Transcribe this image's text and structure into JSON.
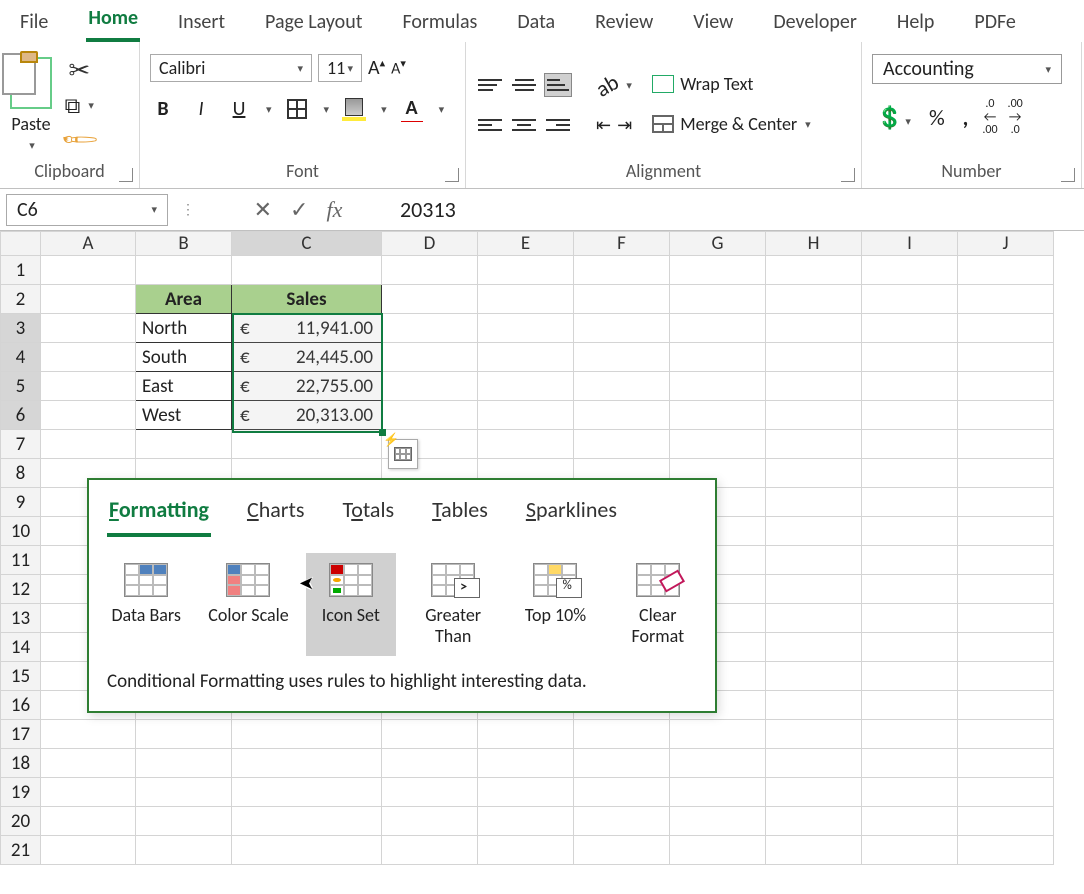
{
  "tabs": {
    "file": "File",
    "home": "Home",
    "insert": "Insert",
    "page_layout": "Page Layout",
    "formulas": "Formulas",
    "data": "Data",
    "review": "Review",
    "view": "View",
    "developer": "Developer",
    "help": "Help",
    "pdf": "PDFe"
  },
  "ribbon": {
    "clipboard": {
      "label": "Clipboard",
      "paste": "Paste"
    },
    "font": {
      "label": "Font",
      "name": "Calibri",
      "size": "11",
      "grow": "A",
      "shrink": "A"
    },
    "alignment": {
      "label": "Alignment",
      "wrap": "Wrap Text",
      "merge": "Merge & Center"
    },
    "number": {
      "label": "Number",
      "format": "Accounting"
    }
  },
  "namebar": {
    "cell_ref": "C6",
    "formula": "20313"
  },
  "columns": [
    "A",
    "B",
    "C",
    "D",
    "E",
    "F",
    "G",
    "H",
    "I",
    "J"
  ],
  "rows": [
    "1",
    "2",
    "3",
    "4",
    "5",
    "6",
    "7",
    "8",
    "9",
    "10",
    "11",
    "12",
    "13",
    "14",
    "15",
    "16",
    "17",
    "18",
    "19",
    "20",
    "21"
  ],
  "table": {
    "headers": {
      "area": "Area",
      "sales": "Sales"
    },
    "currency": "€",
    "rows": [
      {
        "area": "North",
        "sales": "11,941.00"
      },
      {
        "area": "South",
        "sales": "24,445.00"
      },
      {
        "area": "East",
        "sales": "22,755.00"
      },
      {
        "area": "West",
        "sales": "20,313.00"
      }
    ]
  },
  "qa": {
    "tabs": {
      "formatting": "ormatting",
      "formatting_u": "F",
      "charts": "harts",
      "charts_u": "C",
      "totals": "otals",
      "totals_u": "T",
      "tables": "ables",
      "tables_u": "T",
      "sparklines": "parklines",
      "sparklines_u": "S"
    },
    "items": {
      "data_bars": "Data Bars",
      "color_scale": "Color Scale",
      "icon_set": "Icon Set",
      "greater_than": "Greater Than",
      "top_10": "Top 10%",
      "clear_format": "Clear Format"
    },
    "greater_sym": ">",
    "top10_sym": "%",
    "description": "Conditional Formatting uses rules to highlight interesting data."
  }
}
